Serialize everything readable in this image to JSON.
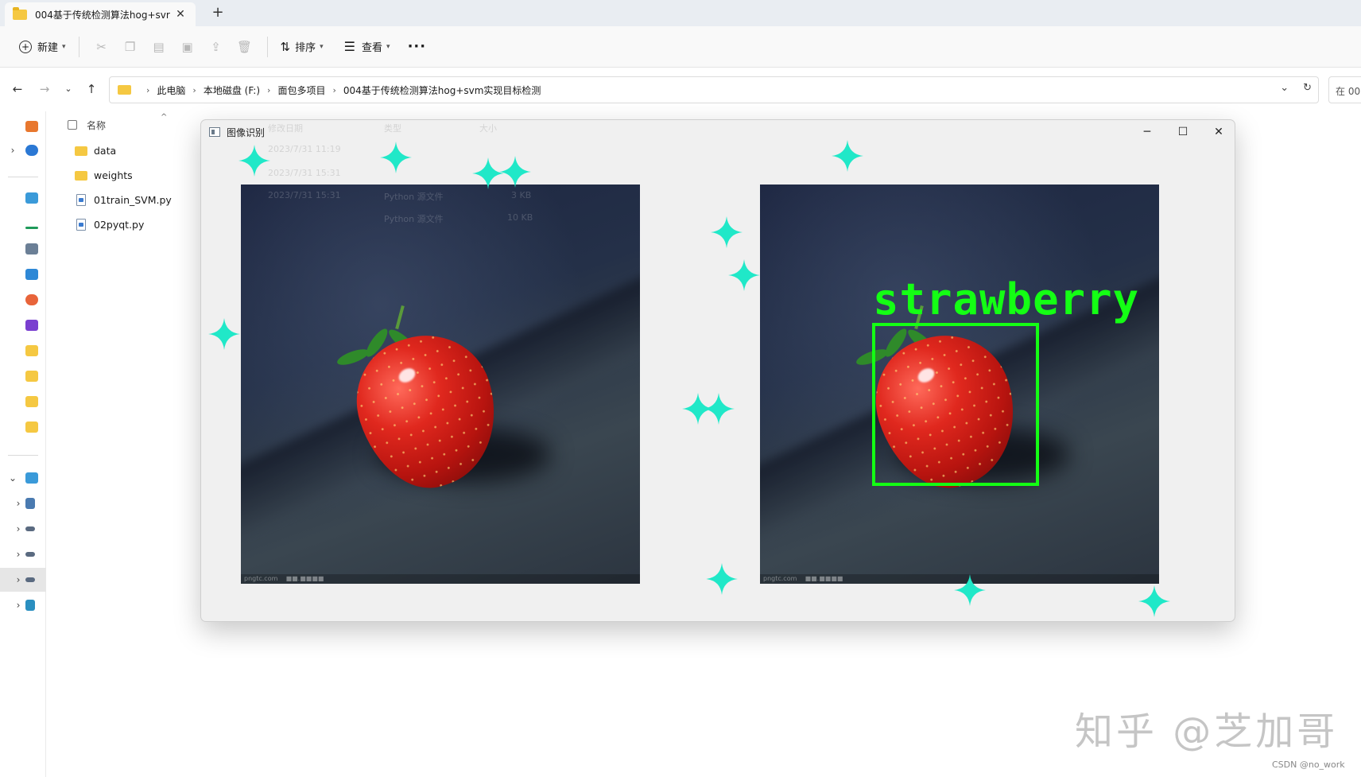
{
  "tab": {
    "title": "004基于传统检测算法hog+svr",
    "close": "✕",
    "new_tab": "+"
  },
  "toolbar": {
    "new_label": "新建",
    "sort_label": "排序",
    "view_label": "查看",
    "more_label": "···"
  },
  "address": {
    "crumbs": [
      "此电脑",
      "本地磁盘 (F:)",
      "面包多项目",
      "004基于传统检测算法hog+svm实现目标检测"
    ],
    "search_placeholder": "在 00"
  },
  "filelist": {
    "header_name": "名称",
    "items": [
      {
        "name": "data",
        "kind": "folder"
      },
      {
        "name": "weights",
        "kind": "folder"
      },
      {
        "name": "01train_SVM.py",
        "kind": "py"
      },
      {
        "name": "02pyqt.py",
        "kind": "py"
      }
    ]
  },
  "qtwindow": {
    "title": "图像识别",
    "ghost_text": [
      "修改日期",
      "类型",
      "大小",
      "2023/7/31 11:19",
      "2023/7/31 15:31",
      "2023/7/31 15:31",
      "Python 源文件",
      "Python 源文件",
      "3 KB",
      "10 KB"
    ]
  },
  "detection": {
    "label": "strawberry"
  },
  "watermarks": {
    "zhihu": "知乎 @芝加哥",
    "csdn": "CSDN @no_work"
  },
  "colors": {
    "sparkle": "#20e8c8",
    "detection": "#14ff14",
    "folder": "#f5c842"
  }
}
